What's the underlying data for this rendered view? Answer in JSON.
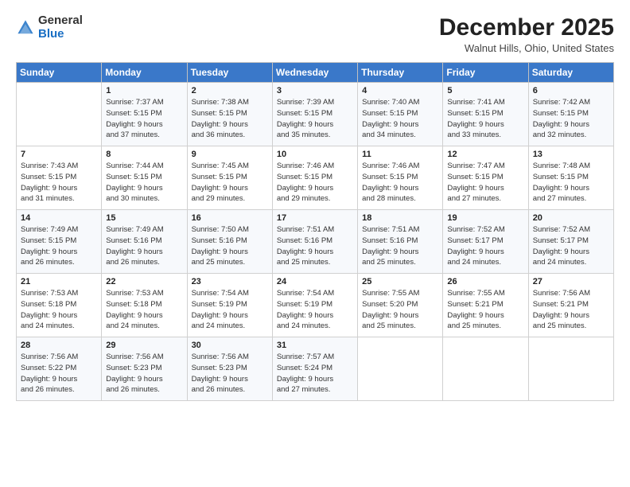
{
  "logo": {
    "general": "General",
    "blue": "Blue"
  },
  "header": {
    "month": "December 2025",
    "location": "Walnut Hills, Ohio, United States"
  },
  "days_of_week": [
    "Sunday",
    "Monday",
    "Tuesday",
    "Wednesday",
    "Thursday",
    "Friday",
    "Saturday"
  ],
  "weeks": [
    [
      {
        "day": "",
        "sunrise": "",
        "sunset": "",
        "daylight": ""
      },
      {
        "day": "1",
        "sunrise": "Sunrise: 7:37 AM",
        "sunset": "Sunset: 5:15 PM",
        "daylight": "Daylight: 9 hours and 37 minutes."
      },
      {
        "day": "2",
        "sunrise": "Sunrise: 7:38 AM",
        "sunset": "Sunset: 5:15 PM",
        "daylight": "Daylight: 9 hours and 36 minutes."
      },
      {
        "day": "3",
        "sunrise": "Sunrise: 7:39 AM",
        "sunset": "Sunset: 5:15 PM",
        "daylight": "Daylight: 9 hours and 35 minutes."
      },
      {
        "day": "4",
        "sunrise": "Sunrise: 7:40 AM",
        "sunset": "Sunset: 5:15 PM",
        "daylight": "Daylight: 9 hours and 34 minutes."
      },
      {
        "day": "5",
        "sunrise": "Sunrise: 7:41 AM",
        "sunset": "Sunset: 5:15 PM",
        "daylight": "Daylight: 9 hours and 33 minutes."
      },
      {
        "day": "6",
        "sunrise": "Sunrise: 7:42 AM",
        "sunset": "Sunset: 5:15 PM",
        "daylight": "Daylight: 9 hours and 32 minutes."
      }
    ],
    [
      {
        "day": "7",
        "sunrise": "Sunrise: 7:43 AM",
        "sunset": "Sunset: 5:15 PM",
        "daylight": "Daylight: 9 hours and 31 minutes."
      },
      {
        "day": "8",
        "sunrise": "Sunrise: 7:44 AM",
        "sunset": "Sunset: 5:15 PM",
        "daylight": "Daylight: 9 hours and 30 minutes."
      },
      {
        "day": "9",
        "sunrise": "Sunrise: 7:45 AM",
        "sunset": "Sunset: 5:15 PM",
        "daylight": "Daylight: 9 hours and 29 minutes."
      },
      {
        "day": "10",
        "sunrise": "Sunrise: 7:46 AM",
        "sunset": "Sunset: 5:15 PM",
        "daylight": "Daylight: 9 hours and 29 minutes."
      },
      {
        "day": "11",
        "sunrise": "Sunrise: 7:46 AM",
        "sunset": "Sunset: 5:15 PM",
        "daylight": "Daylight: 9 hours and 28 minutes."
      },
      {
        "day": "12",
        "sunrise": "Sunrise: 7:47 AM",
        "sunset": "Sunset: 5:15 PM",
        "daylight": "Daylight: 9 hours and 27 minutes."
      },
      {
        "day": "13",
        "sunrise": "Sunrise: 7:48 AM",
        "sunset": "Sunset: 5:15 PM",
        "daylight": "Daylight: 9 hours and 27 minutes."
      }
    ],
    [
      {
        "day": "14",
        "sunrise": "Sunrise: 7:49 AM",
        "sunset": "Sunset: 5:15 PM",
        "daylight": "Daylight: 9 hours and 26 minutes."
      },
      {
        "day": "15",
        "sunrise": "Sunrise: 7:49 AM",
        "sunset": "Sunset: 5:16 PM",
        "daylight": "Daylight: 9 hours and 26 minutes."
      },
      {
        "day": "16",
        "sunrise": "Sunrise: 7:50 AM",
        "sunset": "Sunset: 5:16 PM",
        "daylight": "Daylight: 9 hours and 25 minutes."
      },
      {
        "day": "17",
        "sunrise": "Sunrise: 7:51 AM",
        "sunset": "Sunset: 5:16 PM",
        "daylight": "Daylight: 9 hours and 25 minutes."
      },
      {
        "day": "18",
        "sunrise": "Sunrise: 7:51 AM",
        "sunset": "Sunset: 5:16 PM",
        "daylight": "Daylight: 9 hours and 25 minutes."
      },
      {
        "day": "19",
        "sunrise": "Sunrise: 7:52 AM",
        "sunset": "Sunset: 5:17 PM",
        "daylight": "Daylight: 9 hours and 24 minutes."
      },
      {
        "day": "20",
        "sunrise": "Sunrise: 7:52 AM",
        "sunset": "Sunset: 5:17 PM",
        "daylight": "Daylight: 9 hours and 24 minutes."
      }
    ],
    [
      {
        "day": "21",
        "sunrise": "Sunrise: 7:53 AM",
        "sunset": "Sunset: 5:18 PM",
        "daylight": "Daylight: 9 hours and 24 minutes."
      },
      {
        "day": "22",
        "sunrise": "Sunrise: 7:53 AM",
        "sunset": "Sunset: 5:18 PM",
        "daylight": "Daylight: 9 hours and 24 minutes."
      },
      {
        "day": "23",
        "sunrise": "Sunrise: 7:54 AM",
        "sunset": "Sunset: 5:19 PM",
        "daylight": "Daylight: 9 hours and 24 minutes."
      },
      {
        "day": "24",
        "sunrise": "Sunrise: 7:54 AM",
        "sunset": "Sunset: 5:19 PM",
        "daylight": "Daylight: 9 hours and 24 minutes."
      },
      {
        "day": "25",
        "sunrise": "Sunrise: 7:55 AM",
        "sunset": "Sunset: 5:20 PM",
        "daylight": "Daylight: 9 hours and 25 minutes."
      },
      {
        "day": "26",
        "sunrise": "Sunrise: 7:55 AM",
        "sunset": "Sunset: 5:21 PM",
        "daylight": "Daylight: 9 hours and 25 minutes."
      },
      {
        "day": "27",
        "sunrise": "Sunrise: 7:56 AM",
        "sunset": "Sunset: 5:21 PM",
        "daylight": "Daylight: 9 hours and 25 minutes."
      }
    ],
    [
      {
        "day": "28",
        "sunrise": "Sunrise: 7:56 AM",
        "sunset": "Sunset: 5:22 PM",
        "daylight": "Daylight: 9 hours and 26 minutes."
      },
      {
        "day": "29",
        "sunrise": "Sunrise: 7:56 AM",
        "sunset": "Sunset: 5:23 PM",
        "daylight": "Daylight: 9 hours and 26 minutes."
      },
      {
        "day": "30",
        "sunrise": "Sunrise: 7:56 AM",
        "sunset": "Sunset: 5:23 PM",
        "daylight": "Daylight: 9 hours and 26 minutes."
      },
      {
        "day": "31",
        "sunrise": "Sunrise: 7:57 AM",
        "sunset": "Sunset: 5:24 PM",
        "daylight": "Daylight: 9 hours and 27 minutes."
      },
      {
        "day": "",
        "sunrise": "",
        "sunset": "",
        "daylight": ""
      },
      {
        "day": "",
        "sunrise": "",
        "sunset": "",
        "daylight": ""
      },
      {
        "day": "",
        "sunrise": "",
        "sunset": "",
        "daylight": ""
      }
    ]
  ]
}
